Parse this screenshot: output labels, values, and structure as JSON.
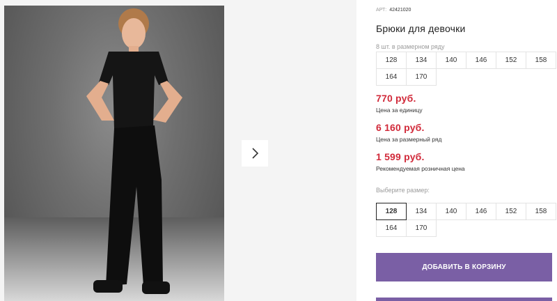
{
  "product": {
    "article_label": "АРТ:",
    "article_number": "42421020",
    "title": "Брюки для девочки",
    "row_note": "8 шт. в размерном ряду",
    "row_sizes": [
      "128",
      "134",
      "140",
      "146",
      "152",
      "158",
      "164",
      "170"
    ]
  },
  "prices": [
    {
      "value": "770 руб.",
      "caption": "Цена за единицу"
    },
    {
      "value": "6 160 руб.",
      "caption": "Цена за размерный ряд"
    },
    {
      "value": "1 599 руб.",
      "caption": "Рекомендуемая розничная цена"
    }
  ],
  "size_picker": {
    "label": "Выберите размер:",
    "sizes": [
      "128",
      "134",
      "140",
      "146",
      "152",
      "158",
      "164",
      "170"
    ],
    "selected": "128"
  },
  "actions": {
    "add_to_cart": "ДОБАВИТЬ В КОРЗИНУ"
  },
  "gallery": {
    "next_icon": "chevron-right-icon"
  },
  "colors": {
    "price": "#d12a3a",
    "button": "#7a5fa5"
  }
}
